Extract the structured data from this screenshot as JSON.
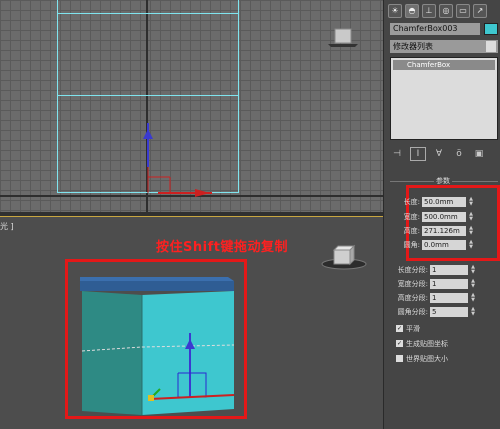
{
  "annotation": "按住Shift键拖动复制",
  "viewport_label": "光 ]",
  "panel": {
    "toolbar_icons": [
      "sun-icon",
      "dome-icon",
      "hierarchy-icon",
      "circle-icon",
      "monitor-icon",
      "hammer-icon"
    ],
    "object_name": "ChamferBox003",
    "object_color": "#3ec7cf",
    "modifier_list_label": "修改器列表",
    "stack_item": "ChamferBox",
    "rollout_title": "参数",
    "params": [
      {
        "label": "长度:",
        "value": "50.0mm"
      },
      {
        "label": "宽度:",
        "value": "500.0mm"
      },
      {
        "label": "高度:",
        "value": "271.126m"
      },
      {
        "label": "圆角:",
        "value": "0.0mm"
      }
    ],
    "segments": [
      {
        "label": "长度分段:",
        "value": "1"
      },
      {
        "label": "宽度分段:",
        "value": "1"
      },
      {
        "label": "高度分段:",
        "value": "1"
      },
      {
        "label": "圆角分段:",
        "value": "5"
      }
    ],
    "checkboxes": [
      {
        "label": "平滑",
        "checked": true
      },
      {
        "label": "生成贴图坐标",
        "checked": true
      },
      {
        "label": "世界贴图大小",
        "checked": false
      }
    ]
  },
  "colors": {
    "accent_red": "#e41818",
    "box_teal": "#3ec7cf",
    "box_top_blue": "#2f5d94",
    "wire_cyan": "#7fe4ee"
  }
}
